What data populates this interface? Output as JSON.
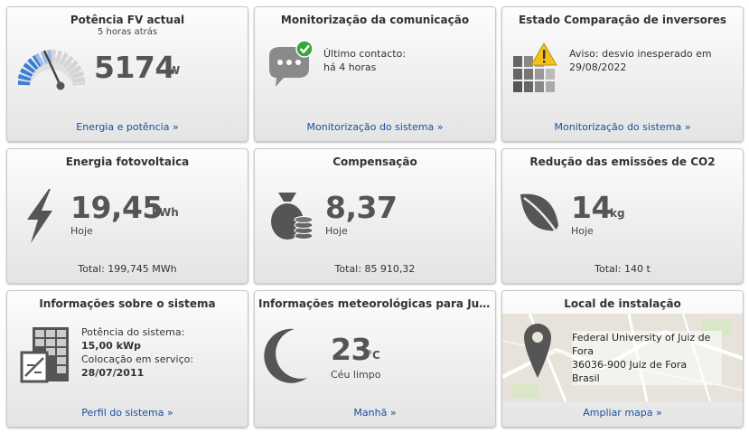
{
  "tiles": {
    "pv_power": {
      "title": "Potência FV actual",
      "subtitle": "5 horas atrás",
      "value": "5174",
      "unit": "W",
      "link": "Energia e potência »"
    },
    "comm": {
      "title": "Monitorização da comunicação",
      "line1": "Último contacto:",
      "line2": "há 4 horas",
      "link": "Monitorização do sistema »"
    },
    "inverters": {
      "title": "Estado Comparação de inversores",
      "line1": "Aviso: desvio inesperado em",
      "line2": "29/08/2022",
      "link": "Monitorização do sistema »"
    },
    "energy": {
      "title": "Energia fotovoltaica",
      "value": "19,45",
      "unit": "kWh",
      "period": "Hoje",
      "total": "Total: 199,745 MWh"
    },
    "compensation": {
      "title": "Compensação",
      "value": "8,37",
      "period": "Hoje",
      "total": "Total: 85 910,32"
    },
    "co2": {
      "title": "Redução das emissões de CO2",
      "value": "14",
      "unit": "kg",
      "period": "Hoje",
      "total": "Total: 140 t"
    },
    "system_info": {
      "title": "Informações sobre o sistema",
      "power_label": "Potência do sistema:",
      "power_value": "15,00 kWp",
      "commissioning_label": "Colocação em serviço:",
      "commissioning_value": "28/07/2011",
      "link": "Perfil do sistema »"
    },
    "weather": {
      "title": "Informações meteorológicas para Jui...",
      "value": "23",
      "unit": "°C",
      "condition": "Céu limpo",
      "link": "Manhã »"
    },
    "location": {
      "title": "Local de instalação",
      "address": [
        "Federal University of Juiz de",
        "Fora",
        "36036-900 Juiz de Fora",
        "Brasil"
      ],
      "link": "Ampliar mapa »"
    }
  },
  "colors": {
    "link": "#1a4fa3",
    "icon_dark": "#555555",
    "gauge_blue": "#3b7dd8",
    "ok_green": "#3aa53a",
    "warning_yellow": "#f2c21a"
  },
  "icons": {
    "pv_power": "gauge-icon",
    "comm": "chat-bubble-check-icon",
    "inverters": "bar-grid-warning-icon",
    "energy": "lightning-icon",
    "compensation": "money-bag-coins-icon",
    "co2": "leaf-icon",
    "system_info": "solar-panel-icon",
    "weather": "crescent-moon-icon",
    "location": "map-pin-icon"
  }
}
